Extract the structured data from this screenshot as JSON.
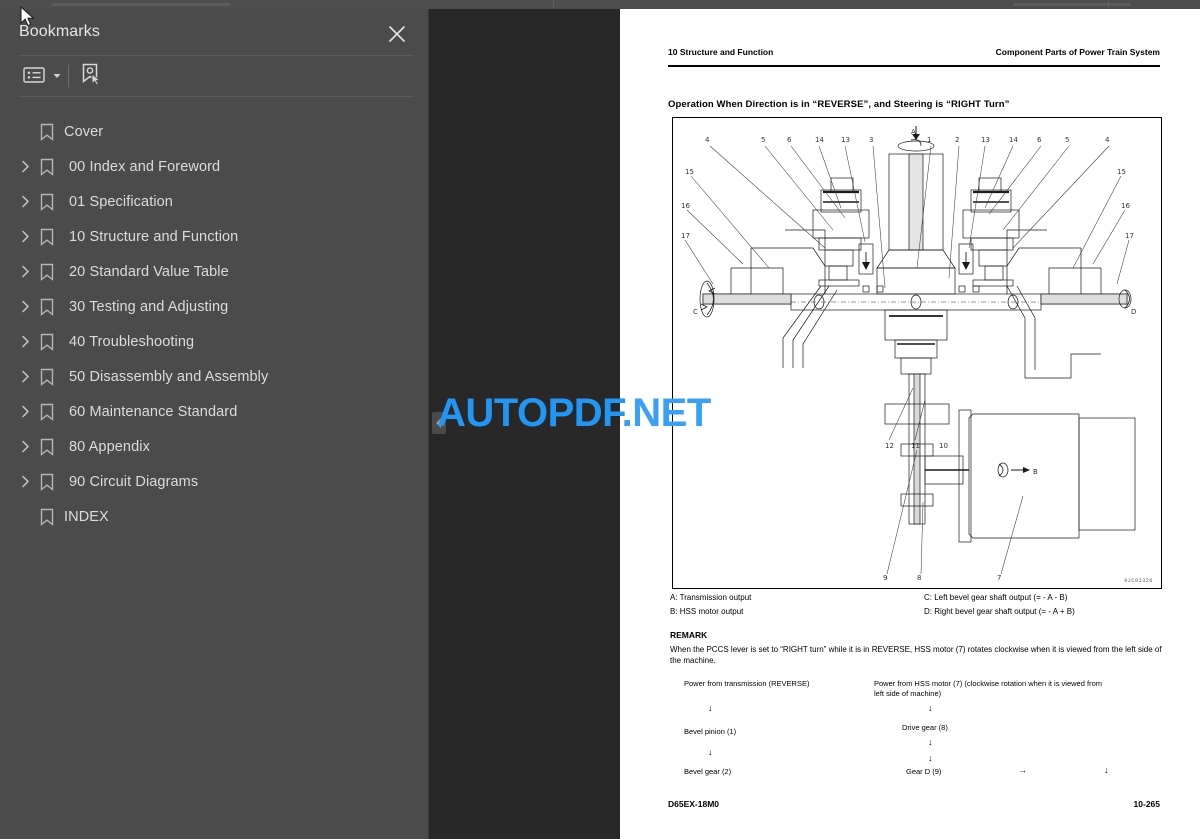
{
  "window": {
    "background_color": "#282828",
    "sidebar_color": "#4b4b4b",
    "accent_color": "#2196f3"
  },
  "sidebar": {
    "title": "Bookmarks",
    "close_icon": "close-icon",
    "toolbar": {
      "options_icon": "list-options-icon",
      "options_caret_icon": "chevron-down-icon",
      "new_bookmark_icon": "new-bookmark-icon"
    },
    "items": [
      {
        "label": "Cover",
        "expandable": false
      },
      {
        "label": "00 Index and Foreword",
        "expandable": true
      },
      {
        "label": "01 Specification",
        "expandable": true
      },
      {
        "label": "10 Structure and Function",
        "expandable": true
      },
      {
        "label": "20 Standard Value Table",
        "expandable": true
      },
      {
        "label": "30 Testing and Adjusting",
        "expandable": true
      },
      {
        "label": "40 Troubleshooting",
        "expandable": true
      },
      {
        "label": "50 Disassembly and Assembly",
        "expandable": true
      },
      {
        "label": "60 Maintenance Standard",
        "expandable": true
      },
      {
        "label": "80 Appendix",
        "expandable": true
      },
      {
        "label": "90 Circuit Diagrams",
        "expandable": true
      },
      {
        "label": "INDEX",
        "expandable": false
      }
    ]
  },
  "viewer": {
    "collapse_handle_icon": "chevron-left-icon",
    "watermark": {
      "text_main": "AUTOPDF",
      "text_tld": ".NET"
    }
  },
  "page": {
    "header_left": "10 Structure and Function",
    "header_right": "Component Parts of Power Train System",
    "section_title": "Operation When Direction is in “REVERSE”, and Steering is “RIGHT Turn”",
    "figure": {
      "drawing_number": "9JC01320",
      "callouts_top_left": [
        "4",
        "5",
        "6",
        "14",
        "13",
        "3"
      ],
      "callouts_left_side": [
        "15",
        "16",
        "17"
      ],
      "callouts_top_right": [
        "1",
        "2",
        "13",
        "14",
        "6",
        "5",
        "4"
      ],
      "callouts_right_side": [
        "15",
        "16",
        "17"
      ],
      "callouts_bottom": [
        "12",
        "11",
        "10",
        "9",
        "8",
        "7"
      ],
      "markers": [
        "A",
        "B",
        "C",
        "D"
      ]
    },
    "legend": [
      "A: Transmission output",
      "B: HSS motor output",
      "C: Left bevel gear shaft output (= - A - B)",
      "D: Right bevel gear shaft output (= - A + B)"
    ],
    "remark_heading": "REMARK",
    "remark_body": "When the PCCS lever is set to “RIGHT turn” while it is in REVERSE, HSS motor (7) rotates clockwise when it is viewed from the left side of the machine.",
    "flow": {
      "left_title": "Power from transmission (REVERSE)",
      "left_steps": [
        "Bevel pinion (1)",
        "Bevel gear (2)"
      ],
      "right_title": "Power from HSS motor (7) (clockwise rotation when it is viewed from left side of machine)",
      "right_steps": [
        "Drive gear (8)",
        "Gear D (9)"
      ],
      "down_arrow": "↓",
      "right_arrow": "→"
    },
    "footer_left": "D65EX-18M0",
    "footer_right": "10-265"
  }
}
